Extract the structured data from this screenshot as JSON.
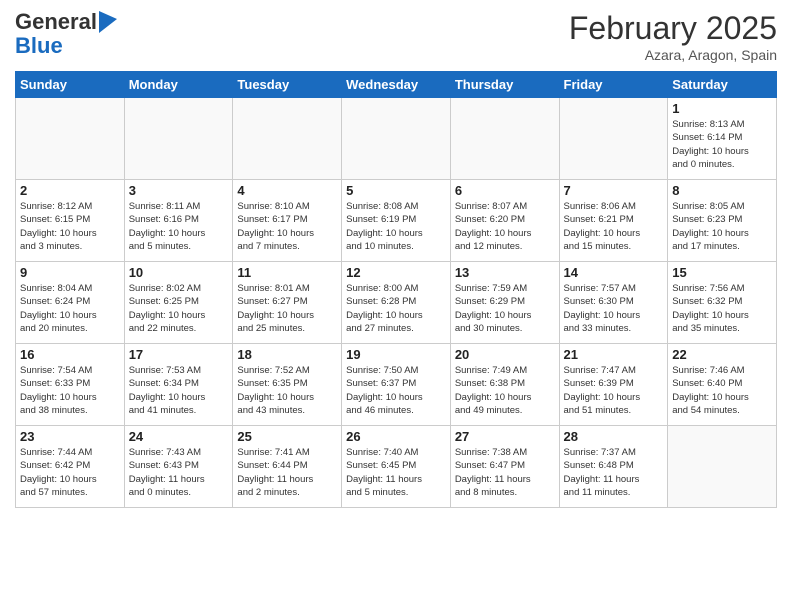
{
  "header": {
    "logo_general": "General",
    "logo_blue": "Blue",
    "month_title": "February 2025",
    "subtitle": "Azara, Aragon, Spain"
  },
  "days_of_week": [
    "Sunday",
    "Monday",
    "Tuesday",
    "Wednesday",
    "Thursday",
    "Friday",
    "Saturday"
  ],
  "weeks": [
    [
      {
        "day": "",
        "info": ""
      },
      {
        "day": "",
        "info": ""
      },
      {
        "day": "",
        "info": ""
      },
      {
        "day": "",
        "info": ""
      },
      {
        "day": "",
        "info": ""
      },
      {
        "day": "",
        "info": ""
      },
      {
        "day": "1",
        "info": "Sunrise: 8:13 AM\nSunset: 6:14 PM\nDaylight: 10 hours\nand 0 minutes."
      }
    ],
    [
      {
        "day": "2",
        "info": "Sunrise: 8:12 AM\nSunset: 6:15 PM\nDaylight: 10 hours\nand 3 minutes."
      },
      {
        "day": "3",
        "info": "Sunrise: 8:11 AM\nSunset: 6:16 PM\nDaylight: 10 hours\nand 5 minutes."
      },
      {
        "day": "4",
        "info": "Sunrise: 8:10 AM\nSunset: 6:17 PM\nDaylight: 10 hours\nand 7 minutes."
      },
      {
        "day": "5",
        "info": "Sunrise: 8:08 AM\nSunset: 6:19 PM\nDaylight: 10 hours\nand 10 minutes."
      },
      {
        "day": "6",
        "info": "Sunrise: 8:07 AM\nSunset: 6:20 PM\nDaylight: 10 hours\nand 12 minutes."
      },
      {
        "day": "7",
        "info": "Sunrise: 8:06 AM\nSunset: 6:21 PM\nDaylight: 10 hours\nand 15 minutes."
      },
      {
        "day": "8",
        "info": "Sunrise: 8:05 AM\nSunset: 6:23 PM\nDaylight: 10 hours\nand 17 minutes."
      }
    ],
    [
      {
        "day": "9",
        "info": "Sunrise: 8:04 AM\nSunset: 6:24 PM\nDaylight: 10 hours\nand 20 minutes."
      },
      {
        "day": "10",
        "info": "Sunrise: 8:02 AM\nSunset: 6:25 PM\nDaylight: 10 hours\nand 22 minutes."
      },
      {
        "day": "11",
        "info": "Sunrise: 8:01 AM\nSunset: 6:27 PM\nDaylight: 10 hours\nand 25 minutes."
      },
      {
        "day": "12",
        "info": "Sunrise: 8:00 AM\nSunset: 6:28 PM\nDaylight: 10 hours\nand 27 minutes."
      },
      {
        "day": "13",
        "info": "Sunrise: 7:59 AM\nSunset: 6:29 PM\nDaylight: 10 hours\nand 30 minutes."
      },
      {
        "day": "14",
        "info": "Sunrise: 7:57 AM\nSunset: 6:30 PM\nDaylight: 10 hours\nand 33 minutes."
      },
      {
        "day": "15",
        "info": "Sunrise: 7:56 AM\nSunset: 6:32 PM\nDaylight: 10 hours\nand 35 minutes."
      }
    ],
    [
      {
        "day": "16",
        "info": "Sunrise: 7:54 AM\nSunset: 6:33 PM\nDaylight: 10 hours\nand 38 minutes."
      },
      {
        "day": "17",
        "info": "Sunrise: 7:53 AM\nSunset: 6:34 PM\nDaylight: 10 hours\nand 41 minutes."
      },
      {
        "day": "18",
        "info": "Sunrise: 7:52 AM\nSunset: 6:35 PM\nDaylight: 10 hours\nand 43 minutes."
      },
      {
        "day": "19",
        "info": "Sunrise: 7:50 AM\nSunset: 6:37 PM\nDaylight: 10 hours\nand 46 minutes."
      },
      {
        "day": "20",
        "info": "Sunrise: 7:49 AM\nSunset: 6:38 PM\nDaylight: 10 hours\nand 49 minutes."
      },
      {
        "day": "21",
        "info": "Sunrise: 7:47 AM\nSunset: 6:39 PM\nDaylight: 10 hours\nand 51 minutes."
      },
      {
        "day": "22",
        "info": "Sunrise: 7:46 AM\nSunset: 6:40 PM\nDaylight: 10 hours\nand 54 minutes."
      }
    ],
    [
      {
        "day": "23",
        "info": "Sunrise: 7:44 AM\nSunset: 6:42 PM\nDaylight: 10 hours\nand 57 minutes."
      },
      {
        "day": "24",
        "info": "Sunrise: 7:43 AM\nSunset: 6:43 PM\nDaylight: 11 hours\nand 0 minutes."
      },
      {
        "day": "25",
        "info": "Sunrise: 7:41 AM\nSunset: 6:44 PM\nDaylight: 11 hours\nand 2 minutes."
      },
      {
        "day": "26",
        "info": "Sunrise: 7:40 AM\nSunset: 6:45 PM\nDaylight: 11 hours\nand 5 minutes."
      },
      {
        "day": "27",
        "info": "Sunrise: 7:38 AM\nSunset: 6:47 PM\nDaylight: 11 hours\nand 8 minutes."
      },
      {
        "day": "28",
        "info": "Sunrise: 7:37 AM\nSunset: 6:48 PM\nDaylight: 11 hours\nand 11 minutes."
      },
      {
        "day": "",
        "info": ""
      }
    ]
  ]
}
